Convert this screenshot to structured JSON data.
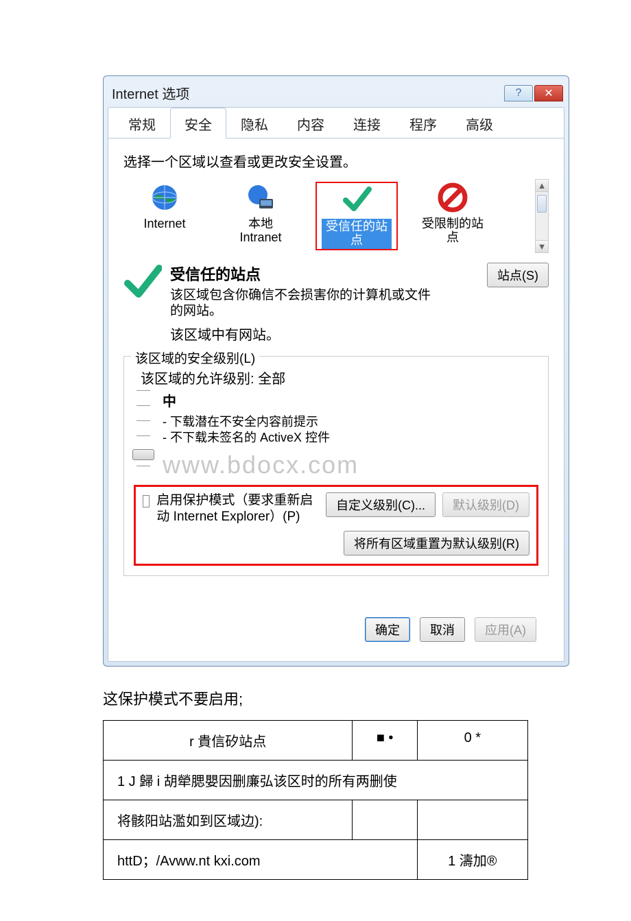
{
  "window": {
    "title": "Internet 选项"
  },
  "tabs": [
    "常规",
    "安全",
    "隐私",
    "内容",
    "连接",
    "程序",
    "高级"
  ],
  "active_tab_index": 1,
  "zone_prompt": "选择一个区域以查看或更改安全设置。",
  "zones": [
    {
      "label": "Internet"
    },
    {
      "label1": "本地",
      "label2": "Intranet"
    },
    {
      "label1": "受信任的站",
      "label2": "点"
    },
    {
      "label1": "受限制的站",
      "label2": "点"
    }
  ],
  "zone_detail": {
    "title": "受信任的站点",
    "desc": "该区域包含你确信不会损害你的计算机或文件的网站。",
    "sub": "该区域中有网站。",
    "sites_button": "站点(S)"
  },
  "sec_group": {
    "legend": "该区域的安全级别(L)",
    "allowed": "该区域的允许级别: 全部",
    "level": "中",
    "bullets": [
      "- 下载潜在不安全内容前提示",
      "- 不下载未签名的 ActiveX 控件"
    ],
    "watermark": "www.bdocx.com"
  },
  "protected_mode": {
    "label": "启用保护模式（要求重新启动 Internet Explorer）(P)",
    "custom_button": "自定义级别(C)...",
    "default_button": "默认级别(D)",
    "reset_button": "将所有区域重置为默认级别(R)"
  },
  "footer": {
    "ok": "确定",
    "cancel": "取消",
    "apply": "应用(A)"
  },
  "caption": "这保护模式不要启用;",
  "lower_table": {
    "r1c1": "r 貴信矽站点",
    "r1c2": "■ •",
    "r1c3": "0 *",
    "r2": "1 J 歸 i 胡犖腮嬰因删廉弘该区时的所有两删使",
    "r3c1": "将骸阳站濫如到区域边):",
    "r4c1": "httD；/Avww.nt kxi.com",
    "r4c2": "1 濤加®"
  }
}
